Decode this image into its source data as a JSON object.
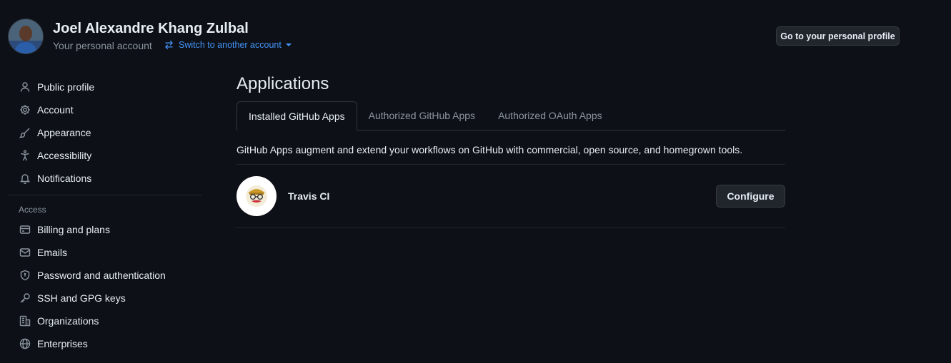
{
  "header": {
    "account_name": "Joel Alexandre Khang Zulbal",
    "account_subtitle": "Your personal account",
    "switch_label": "Switch to another account",
    "profile_button": "Go to your personal profile"
  },
  "sidebar": {
    "items": [
      {
        "label": "Public profile",
        "icon": "person-icon"
      },
      {
        "label": "Account",
        "icon": "gear-icon"
      },
      {
        "label": "Appearance",
        "icon": "paintbrush-icon"
      },
      {
        "label": "Accessibility",
        "icon": "accessibility-icon"
      },
      {
        "label": "Notifications",
        "icon": "bell-icon"
      }
    ],
    "access_label": "Access",
    "access_items": [
      {
        "label": "Billing and plans",
        "icon": "credit-card-icon"
      },
      {
        "label": "Emails",
        "icon": "mail-icon"
      },
      {
        "label": "Password and authentication",
        "icon": "shield-lock-icon"
      },
      {
        "label": "SSH and GPG keys",
        "icon": "key-icon"
      },
      {
        "label": "Organizations",
        "icon": "organization-icon"
      },
      {
        "label": "Enterprises",
        "icon": "globe-icon"
      }
    ]
  },
  "main": {
    "title": "Applications",
    "tabs": [
      {
        "label": "Installed GitHub Apps",
        "active": true
      },
      {
        "label": "Authorized GitHub Apps",
        "active": false
      },
      {
        "label": "Authorized OAuth Apps",
        "active": false
      }
    ],
    "description": "GitHub Apps augment and extend your workflows on GitHub with commercial, open source, and homegrown tools.",
    "apps": [
      {
        "name": "Travis CI",
        "button": "Configure",
        "icon": "travis-ci-logo"
      }
    ]
  },
  "colors": {
    "background": "#0d1117",
    "text": "#e6edf3",
    "muted": "#8b949e",
    "link": "#4493f8",
    "button_bg": "#21262d",
    "border": "#30363d"
  }
}
